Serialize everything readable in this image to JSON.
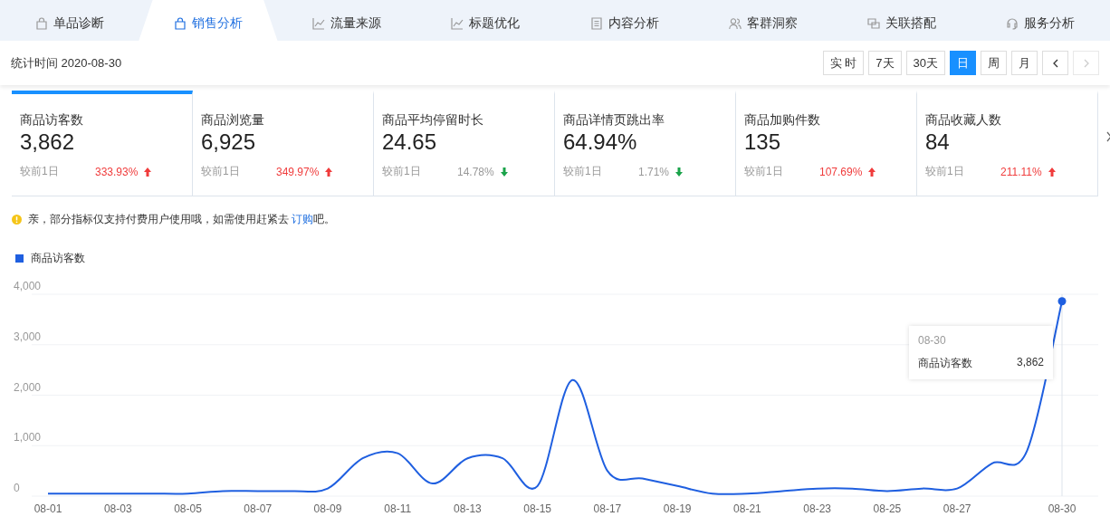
{
  "tabs": [
    {
      "label": "单品诊断",
      "selected": false
    },
    {
      "label": "销售分析",
      "selected": true
    },
    {
      "label": "流量来源",
      "selected": false
    },
    {
      "label": "标题优化",
      "selected": false
    },
    {
      "label": "内容分析",
      "selected": false
    },
    {
      "label": "客群洞察",
      "selected": false
    },
    {
      "label": "关联搭配",
      "selected": false
    },
    {
      "label": "服务分析",
      "selected": false
    }
  ],
  "stat_time": "统计时间 2020-08-30",
  "period_buttons": [
    {
      "label": "实 时",
      "selected": false
    },
    {
      "label": "7天",
      "selected": false
    },
    {
      "label": "30天",
      "selected": false
    },
    {
      "label": "日",
      "selected": true
    },
    {
      "label": "周",
      "selected": false
    },
    {
      "label": "月",
      "selected": false
    }
  ],
  "nav_buttons": [
    {
      "kind": "prev",
      "disabled": false
    },
    {
      "kind": "next",
      "disabled": true
    }
  ],
  "metrics": [
    {
      "title": "商品访客数",
      "value": "3,862",
      "compare_label": "较前1日",
      "change": "333.93%",
      "rising": true,
      "selected": true
    },
    {
      "title": "商品浏览量",
      "value": "6,925",
      "compare_label": "较前1日",
      "change": "349.97%",
      "rising": true,
      "selected": false
    },
    {
      "title": "商品平均停留时长",
      "value": "24.65",
      "compare_label": "较前1日",
      "change": "14.78%",
      "rising": false,
      "selected": false
    },
    {
      "title": "商品详情页跳出率",
      "value": "64.94%",
      "compare_label": "较前1日",
      "change": "1.71%",
      "rising": false,
      "selected": false
    },
    {
      "title": "商品加购件数",
      "value": "135",
      "compare_label": "较前1日",
      "change": "107.69%",
      "rising": true,
      "selected": false
    },
    {
      "title": "商品收藏人数",
      "value": "84",
      "compare_label": "较前1日",
      "change": "211.11%",
      "rising": true,
      "selected": false
    }
  ],
  "notice": {
    "before": "亲，部分指标仅支持付费用户使用哦，如需使用赶紧去 ",
    "link": "订购",
    "after": "吧。"
  },
  "chart": {
    "chart_data": {
      "type": "line",
      "grid": true,
      "categories": [
        "08-01",
        null,
        "08-03",
        null,
        "08-05",
        null,
        "08-07",
        null,
        "08-09",
        null,
        "08-11",
        null,
        "08-13",
        null,
        "08-15",
        null,
        "08-17",
        null,
        "08-19",
        null,
        "08-21",
        null,
        "08-23",
        null,
        "08-25",
        null,
        "08-27",
        null,
        null,
        "08-30"
      ],
      "series": [
        {
          "name": "商品访客数",
          "color": "#1f5fe0",
          "values": [
            50,
            50,
            50,
            50,
            50,
            100,
            100,
            100,
            150,
            750,
            850,
            250,
            750,
            750,
            200,
            2300,
            500,
            350,
            200,
            50,
            50,
            100,
            150,
            150,
            100,
            150,
            150,
            650,
            900,
            3862
          ]
        }
      ],
      "ylim": [
        0,
        4000
      ],
      "yticks": [
        {
          "value": 0,
          "label": "0"
        },
        {
          "value": 1000,
          "label": "1,000"
        },
        {
          "value": 2000,
          "label": "2,000"
        },
        {
          "value": 3000,
          "label": "3,000"
        },
        {
          "value": 4000,
          "label": "4,000"
        }
      ]
    },
    "tooltip": {
      "title": "08-30",
      "series_name": "商品访客数",
      "value": "3,862"
    }
  }
}
